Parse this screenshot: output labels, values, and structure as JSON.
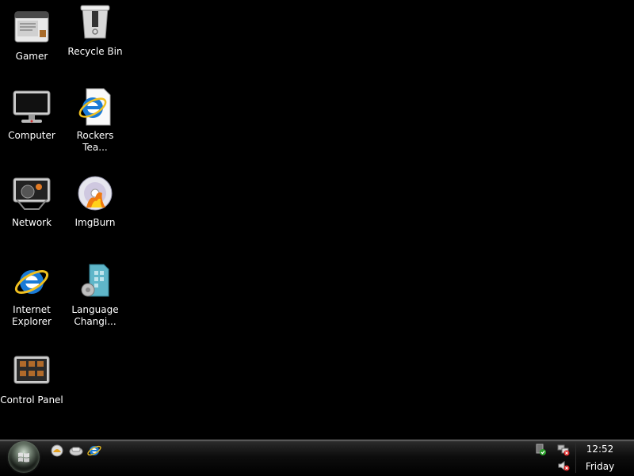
{
  "desktop": {
    "icons": [
      {
        "id": "gamer",
        "label": "Gamer",
        "icon": "gamer-icon"
      },
      {
        "id": "recycle_bin",
        "label": "Recycle Bin",
        "icon": "recycle-bin-icon"
      },
      {
        "id": "computer",
        "label": "Computer",
        "icon": "computer-icon"
      },
      {
        "id": "rockers",
        "label": "Rockers Tea...",
        "icon": "internet-shortcut-icon"
      },
      {
        "id": "network",
        "label": "Network",
        "icon": "network-icon"
      },
      {
        "id": "imgburn",
        "label": "ImgBurn",
        "icon": "imgburn-icon"
      },
      {
        "id": "ie",
        "label": "Internet\nExplorer",
        "icon": "internet-explorer-icon"
      },
      {
        "id": "language",
        "label": "Language\nChangi...",
        "icon": "language-changer-icon"
      },
      {
        "id": "control_panel",
        "label": "Control Panel",
        "icon": "control-panel-icon"
      }
    ]
  },
  "taskbar": {
    "start_button": "start-orb",
    "quick_launch": [
      "show-desktop-icon",
      "switch-windows-icon",
      "internet-explorer-icon"
    ],
    "tray": {
      "icons": [
        "security-center-icon",
        "network-disconnected-icon",
        "volume-muted-icon"
      ],
      "clock": {
        "time": "12:52",
        "day": "Friday"
      }
    }
  },
  "colors": {
    "background": "#000000",
    "taskbar": "#0d0d0d",
    "label": "#ffffff",
    "ie_blue": "#1a7ad6",
    "ie_ring": "#f0c020"
  }
}
